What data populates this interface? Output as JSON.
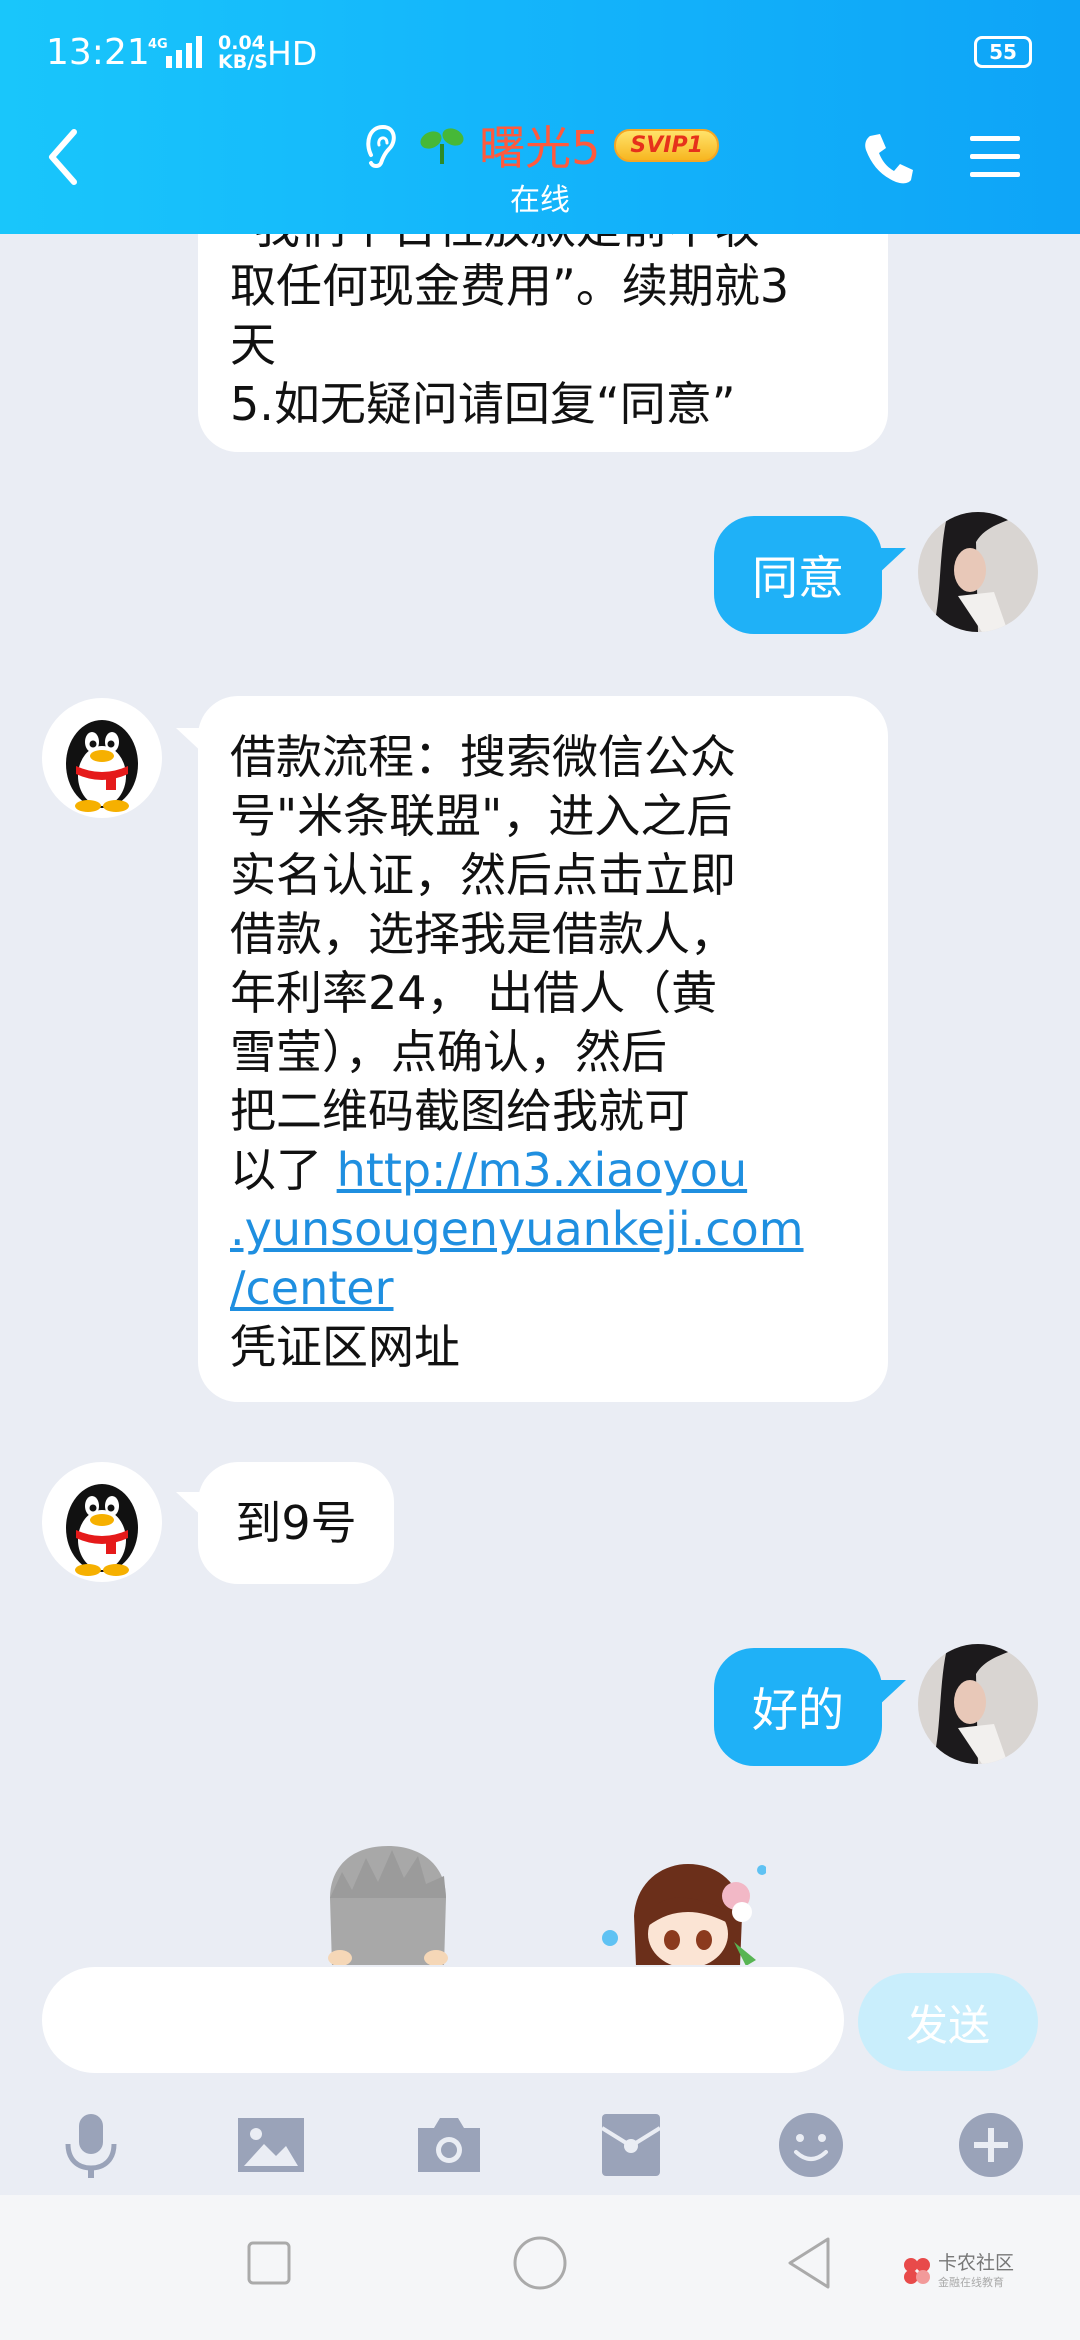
{
  "status_bar": {
    "time": "13:21",
    "network": "4G",
    "speed_value": "0.04",
    "speed_unit": "KB/S",
    "hd": "HD",
    "battery": "55"
  },
  "header": {
    "contact_name": "曙光5",
    "svip": "SVIP1",
    "status": "在线"
  },
  "messages": {
    "m1": {
      "lines": [
        "“我们平台性放款是前不收",
        "取任何现金费用”。续期就3",
        "天",
        "5.如无疑问请回复“同意”"
      ]
    },
    "m2": {
      "text": "同意"
    },
    "m3": {
      "lines": [
        "借款流程：搜索微信公众",
        "号\"米条联盟\"，进入之后",
        "实名认证，然后点击立即",
        "借款，选择我是借款人，",
        "年利率24， 出借人（黄",
        "雪莹），点确认，然后",
        "把二维码截图给我就可"
      ],
      "line8_prefix": "以了 ",
      "link_lines": [
        "http://m3.xiaoyou",
        ".yunsougenyuankeji.com",
        "/center"
      ],
      "last_line": "凭证区网址"
    },
    "m4": {
      "text": "到9号"
    },
    "m5": {
      "text": "好的"
    }
  },
  "input": {
    "placeholder": "",
    "send_label": "发送"
  },
  "toolbar": {
    "icons": [
      "mic-icon",
      "image-icon",
      "camera-icon",
      "red-packet-icon",
      "emoji-icon",
      "plus-icon"
    ]
  },
  "watermark": {
    "title": "卡农社区",
    "subtitle": "金融在线教育"
  },
  "colors": {
    "header": "#14b6fb",
    "bubble_out": "#1fb1f7",
    "name": "#ff5a3d",
    "link": "#1f8fe0",
    "background": "#eaedf4"
  }
}
